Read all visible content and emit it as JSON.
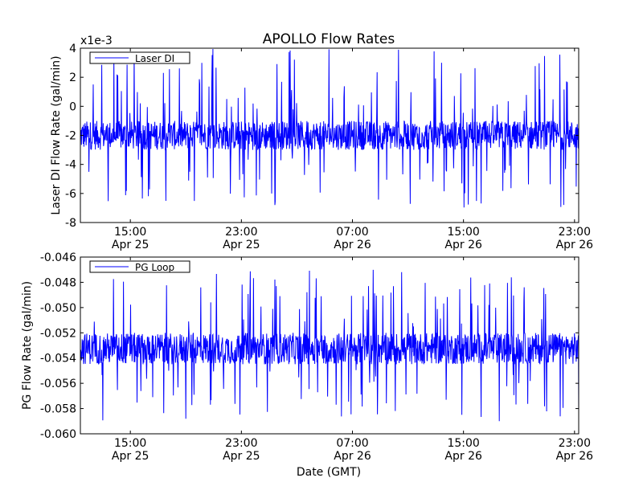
{
  "figure": {
    "title": "APOLLO Flow Rates",
    "xlabel": "Date (GMT)",
    "line_color": "#0000ff"
  },
  "chart_data": [
    {
      "type": "line",
      "title": "APOLLO Flow Rates",
      "ylabel": "Laser DI Flow Rate (gal/min)",
      "scale_note": "x1e-3",
      "ylim": [
        -8,
        4
      ],
      "y_ticks": [
        -8,
        -6,
        -4,
        -2,
        0,
        2,
        4
      ],
      "x_ticks": [
        {
          "t": 15,
          "time": "15:00",
          "date": "Apr 25"
        },
        {
          "t": 23,
          "time": "23:00",
          "date": "Apr 25"
        },
        {
          "t": 31,
          "time": "07:00",
          "date": "Apr 26"
        },
        {
          "t": 39,
          "time": "15:00",
          "date": "Apr 26"
        },
        {
          "t": 47,
          "time": "23:00",
          "date": "Apr 26"
        }
      ],
      "xlim": [
        11.4,
        47.3
      ],
      "legend": {
        "label": "Laser DI",
        "position": "upper-left"
      },
      "series": [
        {
          "name": "Laser DI",
          "pattern": "noisy",
          "baseline_band": [
            -3,
            -1
          ],
          "min": -7,
          "max": 4
        }
      ]
    },
    {
      "type": "line",
      "ylabel": "PG Flow Rate (gal/min)",
      "ylim": [
        -0.06,
        -0.046
      ],
      "y_ticks": [
        -0.06,
        -0.058,
        -0.056,
        -0.054,
        -0.052,
        -0.05,
        -0.048,
        -0.046
      ],
      "x_ticks": [
        {
          "t": 15,
          "time": "15:00",
          "date": "Apr 25"
        },
        {
          "t": 23,
          "time": "23:00",
          "date": "Apr 25"
        },
        {
          "t": 31,
          "time": "07:00",
          "date": "Apr 26"
        },
        {
          "t": 39,
          "time": "15:00",
          "date": "Apr 26"
        },
        {
          "t": 47,
          "time": "23:00",
          "date": "Apr 26"
        }
      ],
      "xlim": [
        11.4,
        47.3
      ],
      "legend": {
        "label": "PG Loop",
        "position": "upper-left"
      },
      "series": [
        {
          "name": "PG Loop",
          "pattern": "noisy",
          "baseline_band": [
            -0.0545,
            -0.052
          ],
          "min": -0.059,
          "max": -0.047
        }
      ]
    }
  ]
}
